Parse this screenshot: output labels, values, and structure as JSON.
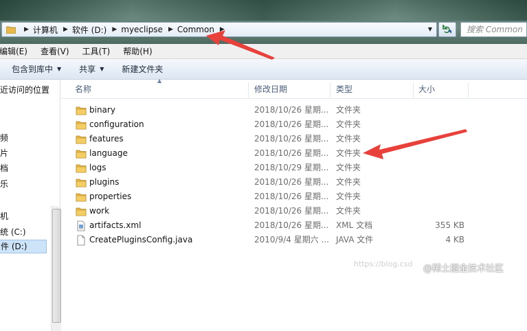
{
  "address": {
    "breadcrumbs": [
      "计算机",
      "软件 (D:)",
      "myeclipse",
      "Common"
    ]
  },
  "search": {
    "placeholder": "搜索 Common"
  },
  "menu": [
    "编辑(E)",
    "查看(V)",
    "工具(T)",
    "帮助(H)"
  ],
  "toolbar": {
    "include_library": "包含到库中",
    "share": "共享",
    "new_folder": "新建文件夹"
  },
  "nav": {
    "recent": "近访问的位置",
    "items": [
      "频",
      "片",
      "档",
      "乐",
      "机",
      "统 (C:)",
      "件 (D:)"
    ]
  },
  "columns": {
    "name": "名称",
    "date": "修改日期",
    "type": "类型",
    "size": "大小"
  },
  "files": [
    {
      "name": "binary",
      "date": "2018/10/26 星期...",
      "type": "文件夹",
      "size": "",
      "icon": "folder-icon"
    },
    {
      "name": "configuration",
      "date": "2018/10/26 星期...",
      "type": "文件夹",
      "size": "",
      "icon": "folder-icon"
    },
    {
      "name": "features",
      "date": "2018/10/26 星期...",
      "type": "文件夹",
      "size": "",
      "icon": "folder-icon"
    },
    {
      "name": "language",
      "date": "2018/10/26 星期...",
      "type": "文件夹",
      "size": "",
      "icon": "folder-icon"
    },
    {
      "name": "logs",
      "date": "2018/10/29 星期...",
      "type": "文件夹",
      "size": "",
      "icon": "folder-icon"
    },
    {
      "name": "plugins",
      "date": "2018/10/26 星期...",
      "type": "文件夹",
      "size": "",
      "icon": "folder-icon"
    },
    {
      "name": "properties",
      "date": "2018/10/26 星期...",
      "type": "文件夹",
      "size": "",
      "icon": "folder-icon"
    },
    {
      "name": "work",
      "date": "2018/10/26 星期...",
      "type": "文件夹",
      "size": "",
      "icon": "folder-icon"
    },
    {
      "name": "artifacts.xml",
      "date": "2018/10/26 星期...",
      "type": "XML 文档",
      "size": "355 KB",
      "icon": "xml-file-icon"
    },
    {
      "name": "CreatePluginsConfig.java",
      "date": "2010/9/4 星期六 ...",
      "type": "JAVA 文件",
      "size": "4 KB",
      "icon": "java-file-icon"
    }
  ],
  "watermark": "https://blog.csd",
  "brand": "@稀土掘金技术社区",
  "colors": {
    "annotation_arrow": "#e8403a",
    "folder": "#e8b84a"
  }
}
